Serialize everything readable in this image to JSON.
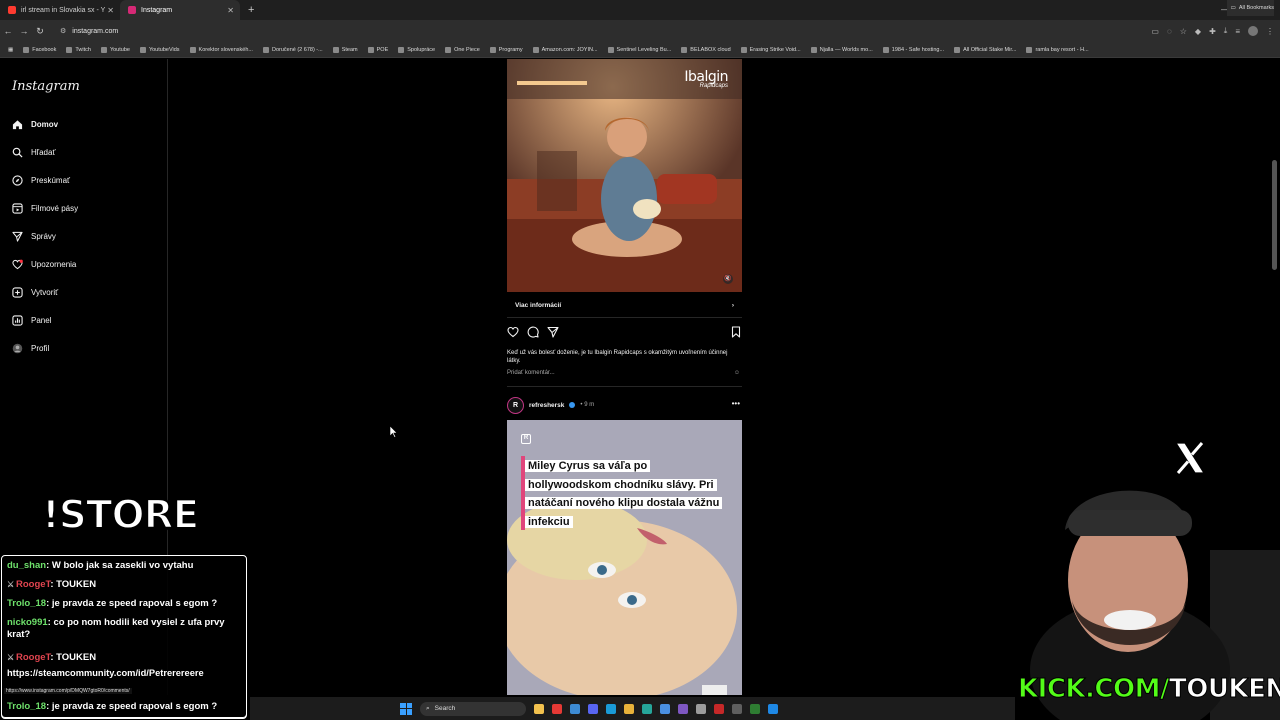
{
  "browser": {
    "tabs": [
      {
        "title": "irl stream in Slovakia sx - Y",
        "active": false,
        "favicon_color": "#ff3b30"
      },
      {
        "title": "Instagram",
        "active": true,
        "favicon_color": "#d62976"
      }
    ],
    "url": "instagram.com",
    "bookmarks": [
      "Facebook",
      "Twitch",
      "Youtube",
      "YoutubeVids",
      "Korektor slovenskéh...",
      "Doručené (2 678) -...",
      "Steam",
      "POE",
      "Spolupráce",
      "One Piece",
      "Programy",
      "Amazon.com: JOYIN...",
      "Sentinel Leveling Bu...",
      "BELABOX cloud",
      "Erasing Strike Void...",
      "Njalla — Worlds mo...",
      "1984 - Safe hosting...",
      "All Official Stake Mir...",
      "ramla bay resort - H..."
    ],
    "all_bookmarks": "All Bookmarks"
  },
  "instagram": {
    "logo": "Instagram",
    "nav": [
      {
        "label": "Domov",
        "icon": "home-icon"
      },
      {
        "label": "Hľadať",
        "icon": "search-icon"
      },
      {
        "label": "Preskúmať",
        "icon": "compass-icon"
      },
      {
        "label": "Filmové pásy",
        "icon": "reels-icon"
      },
      {
        "label": "Správy",
        "icon": "send-icon"
      },
      {
        "label": "Upozornenia",
        "icon": "heart-icon"
      },
      {
        "label": "Vytvoriť",
        "icon": "plus-icon"
      },
      {
        "label": "Panel",
        "icon": "dashboard-icon"
      },
      {
        "label": "Profil",
        "icon": "avatar-icon"
      }
    ],
    "post1": {
      "brand": "Ibalgin",
      "brand_sub": "Rapidcaps",
      "more_info": "Viac informácií",
      "caption": "Keď už vás bolesť doženie, je tu Ibalgin Rapidcaps s okamžitým uvoľnením účinnej látky.",
      "add_comment": "Pridať komentár..."
    },
    "post2": {
      "username": "refreshersk",
      "time": "9 m",
      "headline": "Miley Cyrus sa váľa po hollywoodskom chodníku slávy. Pri natáčaní nového klipu dostala vážnu infekciu"
    }
  },
  "overlay": {
    "store": "!STORE",
    "chat": [
      {
        "user": "du_shan",
        "text": "W bolo jak sa zasekli vo vytahu",
        "color": "green",
        "mod": false
      },
      {
        "user": "RoogeT",
        "text": "TOUKEN",
        "color": "red",
        "mod": true
      },
      {
        "user": "Trolo_18",
        "text": "je pravda ze speed rapoval s egom ?",
        "color": "green",
        "mod": false
      },
      {
        "user": "nicko991",
        "text": "co po nom hodili ked vysiel z ufa prvy krat?",
        "color": "green",
        "mod": false
      },
      {
        "user": "RoogeT",
        "text": "TOUKEN",
        "color": "red",
        "mod": true
      },
      {
        "user": "",
        "text": "https://steamcommunity.com/id/Petrerereere",
        "color": "white",
        "mod": false
      }
    ],
    "last_chat": {
      "user": "Trolo_18",
      "text": "je pravda ze speed rapoval s egom ?"
    },
    "url_hint": "https://www.instagram.com/p/DMQW7gtoR0/comments/",
    "kick_brand": "KICK.COM/",
    "kick_user": "TOUKEN"
  },
  "taskbar": {
    "search_placeholder": "Search"
  }
}
